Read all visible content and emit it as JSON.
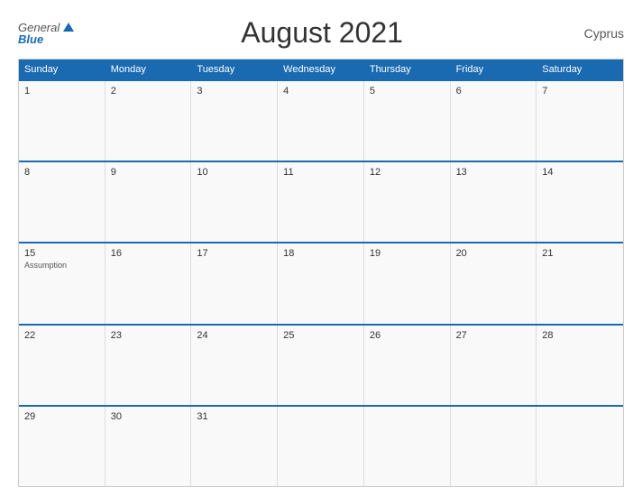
{
  "header": {
    "logo_general": "General",
    "logo_blue": "Blue",
    "title": "August 2021",
    "country": "Cyprus"
  },
  "days": {
    "headers": [
      "Sunday",
      "Monday",
      "Tuesday",
      "Wednesday",
      "Thursday",
      "Friday",
      "Saturday"
    ]
  },
  "weeks": [
    [
      {
        "date": "1",
        "event": ""
      },
      {
        "date": "2",
        "event": ""
      },
      {
        "date": "3",
        "event": ""
      },
      {
        "date": "4",
        "event": ""
      },
      {
        "date": "5",
        "event": ""
      },
      {
        "date": "6",
        "event": ""
      },
      {
        "date": "7",
        "event": ""
      }
    ],
    [
      {
        "date": "8",
        "event": ""
      },
      {
        "date": "9",
        "event": ""
      },
      {
        "date": "10",
        "event": ""
      },
      {
        "date": "11",
        "event": ""
      },
      {
        "date": "12",
        "event": ""
      },
      {
        "date": "13",
        "event": ""
      },
      {
        "date": "14",
        "event": ""
      }
    ],
    [
      {
        "date": "15",
        "event": "Assumption"
      },
      {
        "date": "16",
        "event": ""
      },
      {
        "date": "17",
        "event": ""
      },
      {
        "date": "18",
        "event": ""
      },
      {
        "date": "19",
        "event": ""
      },
      {
        "date": "20",
        "event": ""
      },
      {
        "date": "21",
        "event": ""
      }
    ],
    [
      {
        "date": "22",
        "event": ""
      },
      {
        "date": "23",
        "event": ""
      },
      {
        "date": "24",
        "event": ""
      },
      {
        "date": "25",
        "event": ""
      },
      {
        "date": "26",
        "event": ""
      },
      {
        "date": "27",
        "event": ""
      },
      {
        "date": "28",
        "event": ""
      }
    ],
    [
      {
        "date": "29",
        "event": ""
      },
      {
        "date": "30",
        "event": ""
      },
      {
        "date": "31",
        "event": ""
      },
      {
        "date": "",
        "event": ""
      },
      {
        "date": "",
        "event": ""
      },
      {
        "date": "",
        "event": ""
      },
      {
        "date": "",
        "event": ""
      }
    ]
  ]
}
